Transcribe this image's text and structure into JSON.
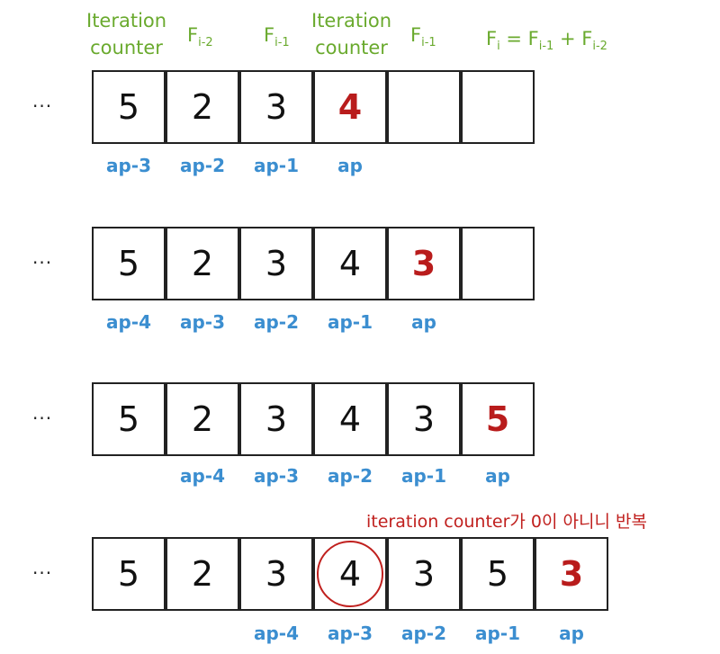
{
  "headers": [
    {
      "main": "Iteration",
      "line2": "counter",
      "sub": ""
    },
    {
      "main": "F",
      "line2": "",
      "sub": "i-2"
    },
    {
      "main": "F",
      "line2": "",
      "sub": "i-1"
    },
    {
      "main": "Iteration",
      "line2": "counter",
      "sub": ""
    },
    {
      "main": "F",
      "line2": "",
      "sub": "i-1"
    }
  ],
  "formula": {
    "f1": "F",
    "s1": "i",
    "eq": " = F",
    "s2": "i-1",
    "plus": " + F",
    "s3": "i-2"
  },
  "ellipsis": "...",
  "rows": [
    {
      "cells": [
        "5",
        "2",
        "3",
        "4",
        "",
        ""
      ],
      "highlight": 3,
      "pointers": [
        "ap-3",
        "ap-2",
        "ap-1",
        "ap",
        "",
        ""
      ]
    },
    {
      "cells": [
        "5",
        "2",
        "3",
        "4",
        "3",
        ""
      ],
      "highlight": 4,
      "pointers": [
        "ap-4",
        "ap-3",
        "ap-2",
        "ap-1",
        "ap",
        ""
      ]
    },
    {
      "cells": [
        "5",
        "2",
        "3",
        "4",
        "3",
        "5"
      ],
      "highlight": 5,
      "pointers": [
        "",
        "ap-4",
        "ap-3",
        "ap-2",
        "ap-1",
        "ap"
      ]
    },
    {
      "cells": [
        "5",
        "2",
        "3",
        "4",
        "3",
        "5",
        "3"
      ],
      "highlight": 6,
      "pointers": [
        "",
        "",
        "ap-4",
        "ap-3",
        "ap-2",
        "ap-1",
        "ap"
      ]
    }
  ],
  "note": "iteration counter가 0이 아니니 반복",
  "colors": {
    "header": "#6aaa2e",
    "pointer": "#3b8ed0",
    "highlight": "#b91c1c",
    "note": "#c0201e"
  }
}
